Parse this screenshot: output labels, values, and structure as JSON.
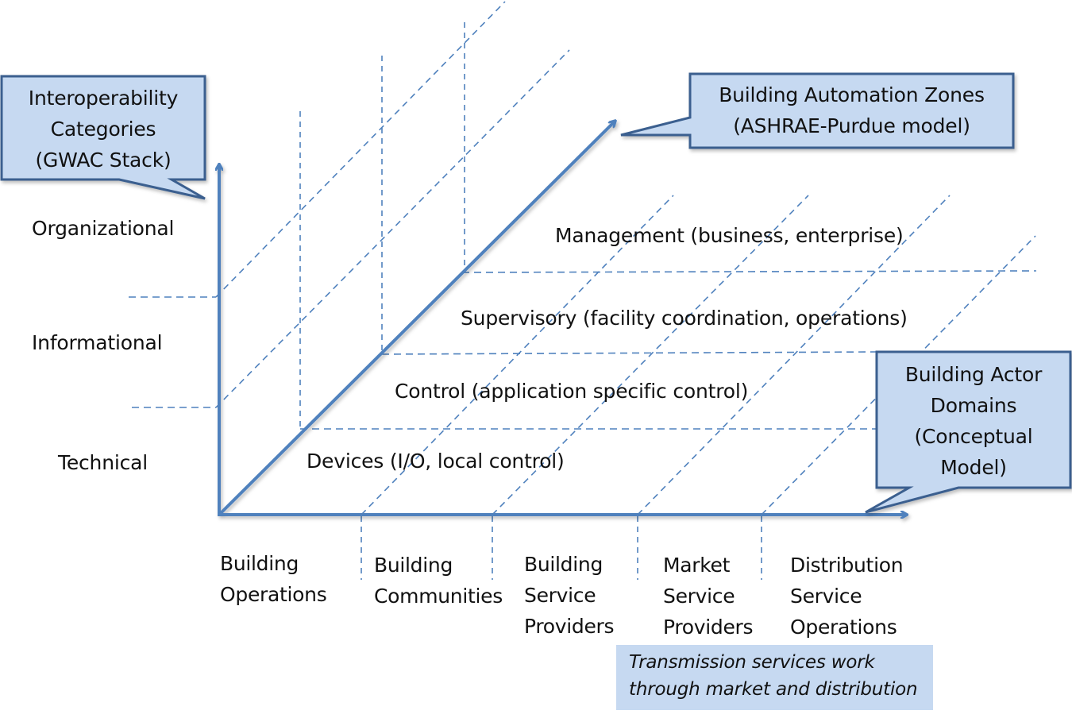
{
  "colors": {
    "axis": "#4f81bd",
    "grid": "#4f81bd",
    "callout_fill": "#c6d9f1",
    "callout_border": "#3a5f8f",
    "note_fill": "#c6d9f1"
  },
  "callouts": {
    "interoperability": {
      "lines": [
        "Interoperability",
        "Categories",
        "(GWAC Stack)"
      ]
    },
    "automation_zones": {
      "lines": [
        "Building Automation Zones",
        "(ASHRAE-Purdue model)"
      ]
    },
    "actor_domains": {
      "lines": [
        "Building Actor",
        "Domains",
        "(Conceptual",
        "Model)"
      ]
    }
  },
  "interoperability_categories": [
    "Organizational",
    "Informational",
    "Technical"
  ],
  "automation_zones": [
    "Management (business, enterprise)",
    "Supervisory (facility coordination, operations)",
    "Control (application specific control)",
    "Devices (I/O, local control)"
  ],
  "actor_domains": [
    {
      "lines": [
        "Building",
        "Operations"
      ]
    },
    {
      "lines": [
        "Building",
        "Communities"
      ]
    },
    {
      "lines": [
        "Building",
        "Service",
        "Providers"
      ]
    },
    {
      "lines": [
        "Market",
        "Service",
        "Providers"
      ]
    },
    {
      "lines": [
        "Distribution",
        "Service",
        "Operations"
      ]
    }
  ],
  "note": {
    "lines": [
      "Transmission services work",
      "through market and distribution"
    ]
  }
}
